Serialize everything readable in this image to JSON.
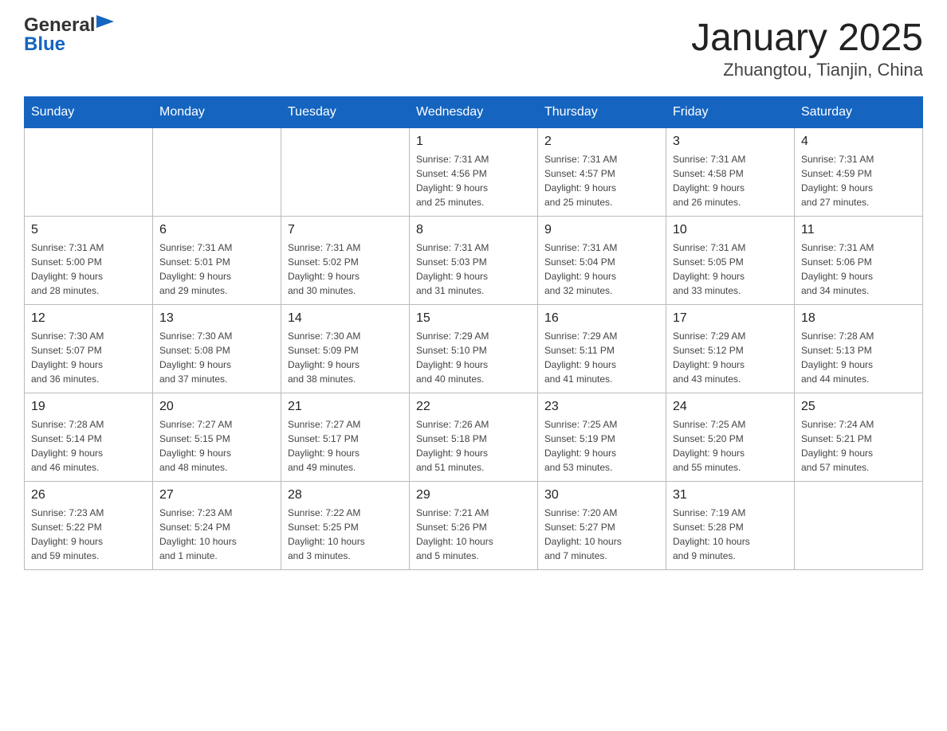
{
  "header": {
    "logo_general": "General",
    "logo_blue": "Blue",
    "title": "January 2025",
    "subtitle": "Zhuangtou, Tianjin, China"
  },
  "days_of_week": [
    "Sunday",
    "Monday",
    "Tuesday",
    "Wednesday",
    "Thursday",
    "Friday",
    "Saturday"
  ],
  "weeks": [
    [
      {
        "day": "",
        "info": ""
      },
      {
        "day": "",
        "info": ""
      },
      {
        "day": "",
        "info": ""
      },
      {
        "day": "1",
        "info": "Sunrise: 7:31 AM\nSunset: 4:56 PM\nDaylight: 9 hours\nand 25 minutes."
      },
      {
        "day": "2",
        "info": "Sunrise: 7:31 AM\nSunset: 4:57 PM\nDaylight: 9 hours\nand 25 minutes."
      },
      {
        "day": "3",
        "info": "Sunrise: 7:31 AM\nSunset: 4:58 PM\nDaylight: 9 hours\nand 26 minutes."
      },
      {
        "day": "4",
        "info": "Sunrise: 7:31 AM\nSunset: 4:59 PM\nDaylight: 9 hours\nand 27 minutes."
      }
    ],
    [
      {
        "day": "5",
        "info": "Sunrise: 7:31 AM\nSunset: 5:00 PM\nDaylight: 9 hours\nand 28 minutes."
      },
      {
        "day": "6",
        "info": "Sunrise: 7:31 AM\nSunset: 5:01 PM\nDaylight: 9 hours\nand 29 minutes."
      },
      {
        "day": "7",
        "info": "Sunrise: 7:31 AM\nSunset: 5:02 PM\nDaylight: 9 hours\nand 30 minutes."
      },
      {
        "day": "8",
        "info": "Sunrise: 7:31 AM\nSunset: 5:03 PM\nDaylight: 9 hours\nand 31 minutes."
      },
      {
        "day": "9",
        "info": "Sunrise: 7:31 AM\nSunset: 5:04 PM\nDaylight: 9 hours\nand 32 minutes."
      },
      {
        "day": "10",
        "info": "Sunrise: 7:31 AM\nSunset: 5:05 PM\nDaylight: 9 hours\nand 33 minutes."
      },
      {
        "day": "11",
        "info": "Sunrise: 7:31 AM\nSunset: 5:06 PM\nDaylight: 9 hours\nand 34 minutes."
      }
    ],
    [
      {
        "day": "12",
        "info": "Sunrise: 7:30 AM\nSunset: 5:07 PM\nDaylight: 9 hours\nand 36 minutes."
      },
      {
        "day": "13",
        "info": "Sunrise: 7:30 AM\nSunset: 5:08 PM\nDaylight: 9 hours\nand 37 minutes."
      },
      {
        "day": "14",
        "info": "Sunrise: 7:30 AM\nSunset: 5:09 PM\nDaylight: 9 hours\nand 38 minutes."
      },
      {
        "day": "15",
        "info": "Sunrise: 7:29 AM\nSunset: 5:10 PM\nDaylight: 9 hours\nand 40 minutes."
      },
      {
        "day": "16",
        "info": "Sunrise: 7:29 AM\nSunset: 5:11 PM\nDaylight: 9 hours\nand 41 minutes."
      },
      {
        "day": "17",
        "info": "Sunrise: 7:29 AM\nSunset: 5:12 PM\nDaylight: 9 hours\nand 43 minutes."
      },
      {
        "day": "18",
        "info": "Sunrise: 7:28 AM\nSunset: 5:13 PM\nDaylight: 9 hours\nand 44 minutes."
      }
    ],
    [
      {
        "day": "19",
        "info": "Sunrise: 7:28 AM\nSunset: 5:14 PM\nDaylight: 9 hours\nand 46 minutes."
      },
      {
        "day": "20",
        "info": "Sunrise: 7:27 AM\nSunset: 5:15 PM\nDaylight: 9 hours\nand 48 minutes."
      },
      {
        "day": "21",
        "info": "Sunrise: 7:27 AM\nSunset: 5:17 PM\nDaylight: 9 hours\nand 49 minutes."
      },
      {
        "day": "22",
        "info": "Sunrise: 7:26 AM\nSunset: 5:18 PM\nDaylight: 9 hours\nand 51 minutes."
      },
      {
        "day": "23",
        "info": "Sunrise: 7:25 AM\nSunset: 5:19 PM\nDaylight: 9 hours\nand 53 minutes."
      },
      {
        "day": "24",
        "info": "Sunrise: 7:25 AM\nSunset: 5:20 PM\nDaylight: 9 hours\nand 55 minutes."
      },
      {
        "day": "25",
        "info": "Sunrise: 7:24 AM\nSunset: 5:21 PM\nDaylight: 9 hours\nand 57 minutes."
      }
    ],
    [
      {
        "day": "26",
        "info": "Sunrise: 7:23 AM\nSunset: 5:22 PM\nDaylight: 9 hours\nand 59 minutes."
      },
      {
        "day": "27",
        "info": "Sunrise: 7:23 AM\nSunset: 5:24 PM\nDaylight: 10 hours\nand 1 minute."
      },
      {
        "day": "28",
        "info": "Sunrise: 7:22 AM\nSunset: 5:25 PM\nDaylight: 10 hours\nand 3 minutes."
      },
      {
        "day": "29",
        "info": "Sunrise: 7:21 AM\nSunset: 5:26 PM\nDaylight: 10 hours\nand 5 minutes."
      },
      {
        "day": "30",
        "info": "Sunrise: 7:20 AM\nSunset: 5:27 PM\nDaylight: 10 hours\nand 7 minutes."
      },
      {
        "day": "31",
        "info": "Sunrise: 7:19 AM\nSunset: 5:28 PM\nDaylight: 10 hours\nand 9 minutes."
      },
      {
        "day": "",
        "info": ""
      }
    ]
  ]
}
